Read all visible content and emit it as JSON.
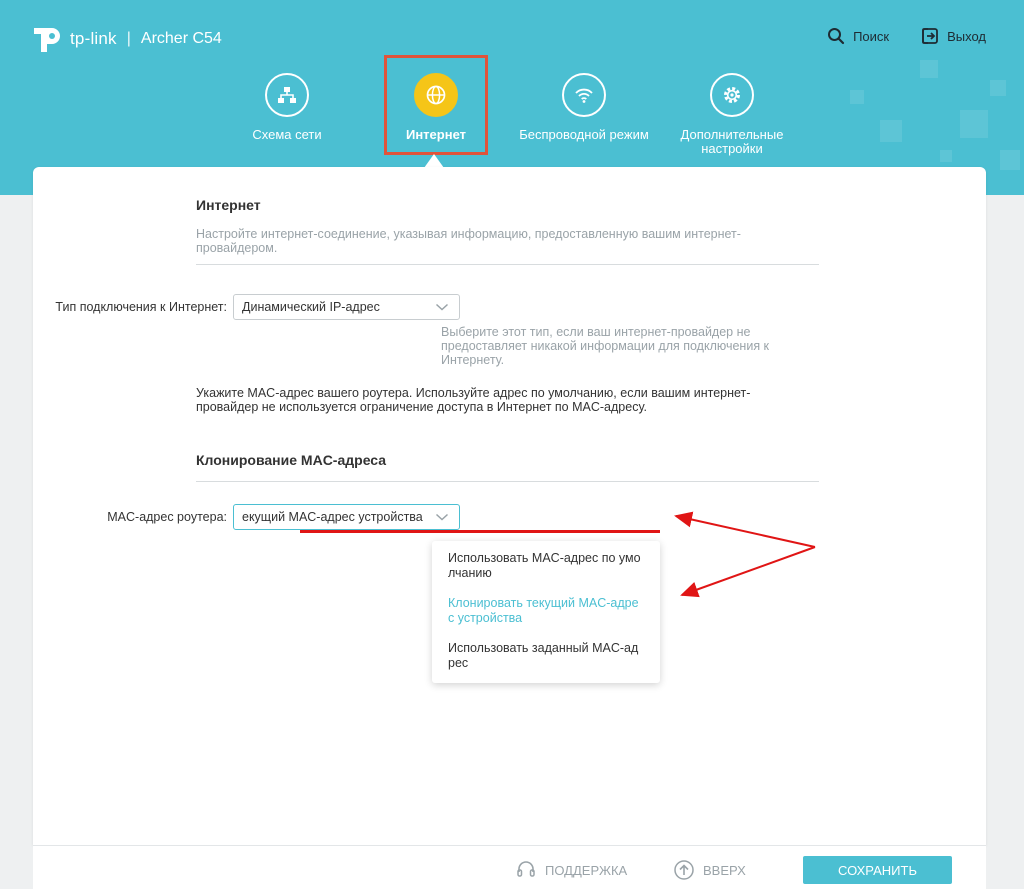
{
  "brand": {
    "logo_text": "tp-link",
    "separator": "|",
    "model": "Archer C54"
  },
  "top_actions": {
    "search": "Поиск",
    "logout": "Выход"
  },
  "nav": {
    "items": [
      {
        "label": "Схема сети",
        "icon": "network-map-icon",
        "active": false
      },
      {
        "label": "Интернет",
        "icon": "globe-icon",
        "active": true
      },
      {
        "label": "Беспроводной режим",
        "icon": "wifi-icon",
        "active": false
      },
      {
        "label": "Дополнительные настройки",
        "icon": "gear-icon",
        "active": false
      }
    ]
  },
  "internet": {
    "title": "Интернет",
    "description": "Настройте интернет-соединение, указывая информацию, предоставленную вашим интернет-провайдером.",
    "connection_type_label": "Тип подключения к Интернет:",
    "connection_type_value": "Динамический IP-адрес",
    "connection_type_hint": "Выберите этот тип, если ваш интернет-провайдер не предоставляет никакой информации для подключения к Интернету.",
    "mac_note": "Укажите MAC-адрес вашего роутера. Используйте адрес по умолчанию, если вашим интернет-провайдер не используется ограничение доступа в Интернет по MAC-адресу."
  },
  "mac_clone": {
    "title": "Клонирование MAC-адреса",
    "router_mac_label": "MAC-адрес роутера:",
    "router_mac_value": "екущий MAC-адрес устройства",
    "options": [
      {
        "label": "Использовать MAC-адрес по умолчанию",
        "selected": false
      },
      {
        "label": "Клонировать текущий MAC-адрес устройства",
        "selected": true
      },
      {
        "label": "Использовать заданный MAC-адрес",
        "selected": false
      }
    ]
  },
  "footer": {
    "support": "ПОДДЕРЖКА",
    "top": "ВВЕРХ",
    "save": "СОХРАНИТЬ"
  },
  "colors": {
    "accent": "#4bbfd2",
    "active_nav": "#f5c518",
    "highlight": "#e0533a",
    "annotation": "#e01515"
  }
}
